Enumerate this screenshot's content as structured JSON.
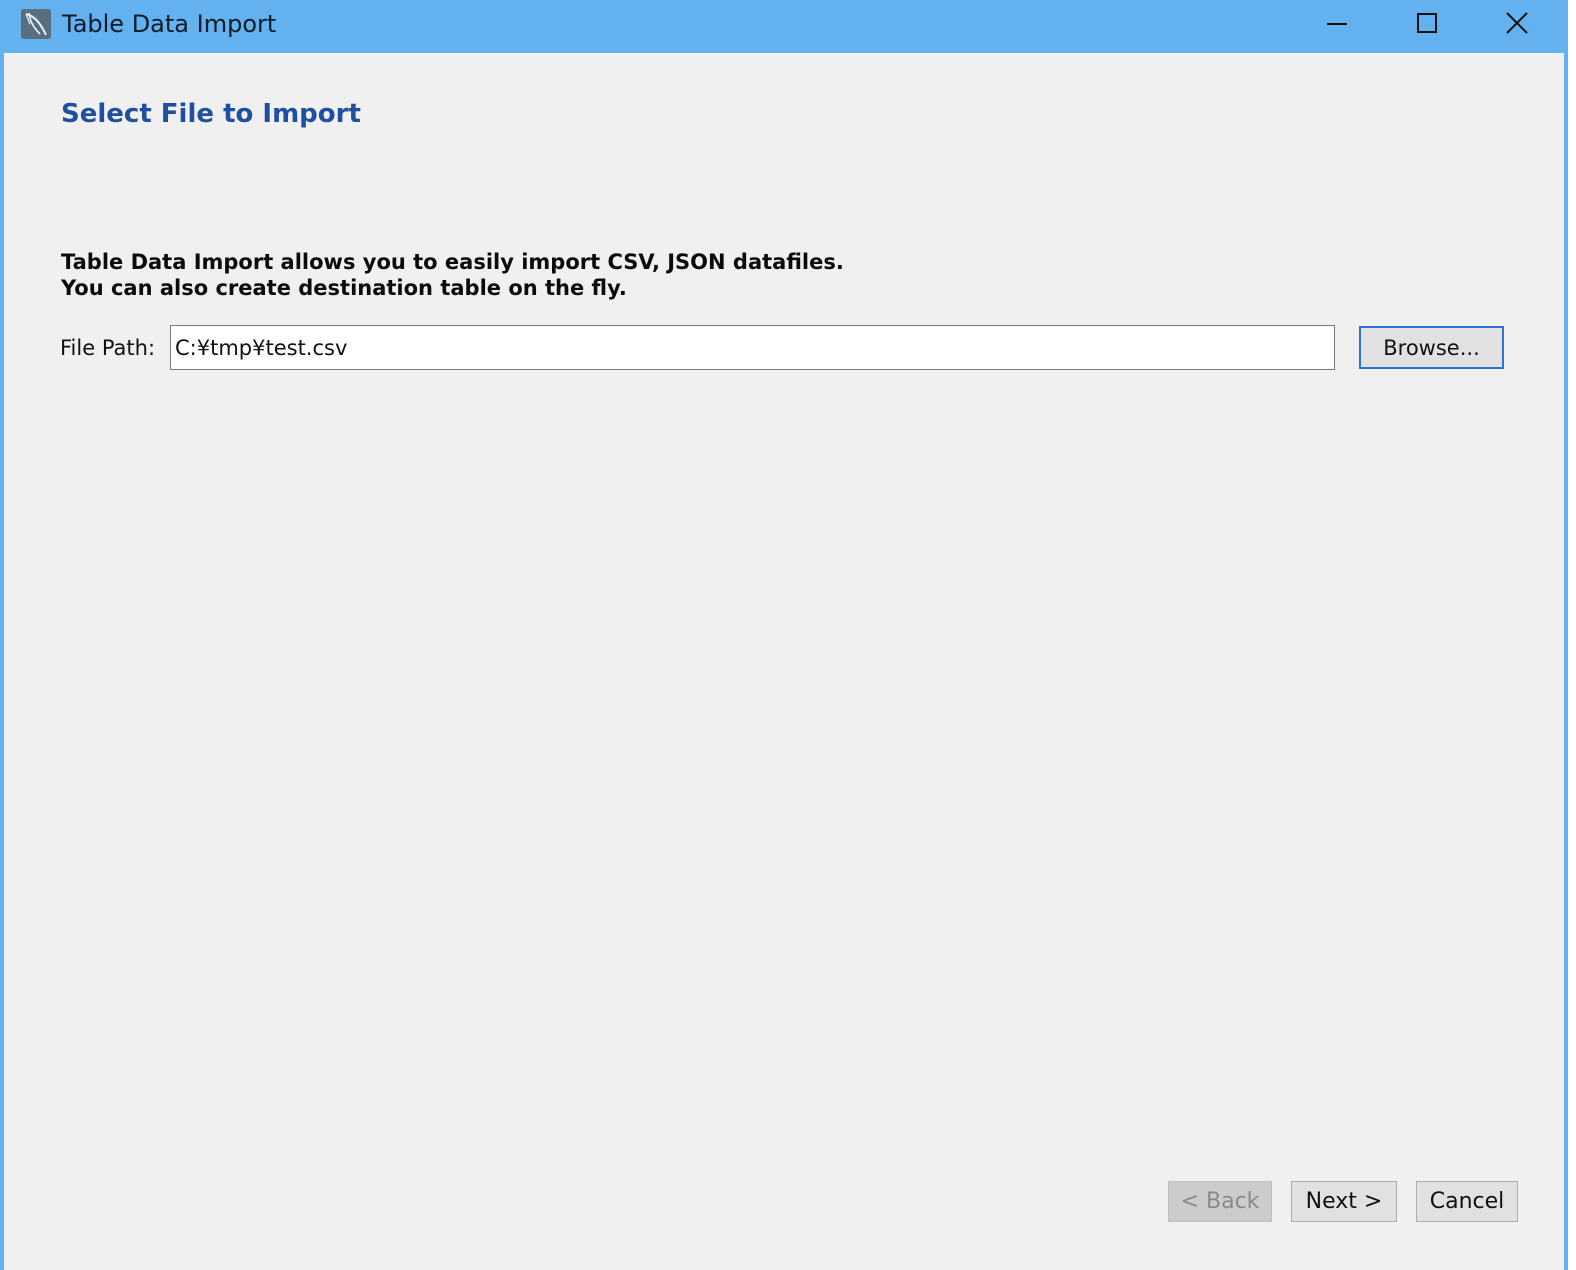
{
  "window": {
    "title": "Table Data Import",
    "accent_color": "#63b1ee",
    "app_icon": "dolphin-icon",
    "controls": {
      "minimize_icon": "minimize-icon",
      "maximize_icon": "maximize-icon",
      "close_icon": "close-icon"
    }
  },
  "page": {
    "title": "Select File to Import",
    "title_color": "#1f4fa0",
    "description_line1": "Table Data Import allows you to easily import CSV, JSON datafiles.",
    "description_line2": "You can also create destination table on the fly."
  },
  "file": {
    "label": "File Path:",
    "value": "C:¥tmp¥test.csv",
    "browse_label": "Browse..."
  },
  "footer": {
    "back_label": "< Back",
    "back_enabled": false,
    "next_label": "Next >",
    "cancel_label": "Cancel"
  }
}
